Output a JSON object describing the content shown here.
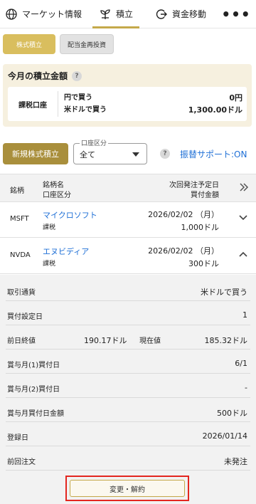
{
  "nav": {
    "market": "マーケット情報",
    "accumulate": "積立",
    "funds": "資金移動",
    "more": "•••"
  },
  "subtabs": {
    "stock": "株式積立",
    "dividend": "配当金再投資"
  },
  "summary": {
    "title": "今月の積立金額",
    "help": "?",
    "account": "課税口座",
    "rows": [
      {
        "label": "円で買う",
        "value": "0円"
      },
      {
        "label": "米ドルで買う",
        "value": "1,300.00ドル"
      }
    ]
  },
  "actions": {
    "new_button": "新規株式積立",
    "account_select_legend": "口座区分",
    "account_select_value": "全て",
    "help": "?",
    "swap_support": "振替サポート:ON"
  },
  "table": {
    "headers": {
      "symbol": "銘柄",
      "name": "銘柄名",
      "account": "口座区分",
      "next_date": "次回発注予定日",
      "amount": "買付金額"
    },
    "rows": [
      {
        "symbol": "MSFT",
        "name": "マイクロソフト",
        "account": "課税",
        "date": "2026/02/02 （月）",
        "amount": "1,000ドル"
      },
      {
        "symbol": "NVDA",
        "name": "エヌビディア",
        "account": "課税",
        "date": "2026/02/02 （月）",
        "amount": "300ドル"
      }
    ]
  },
  "detail": {
    "currency_label": "取引通貨",
    "currency_value": "米ドルで買う",
    "buy_day_label": "買付設定日",
    "buy_day_value": "1",
    "prev_close_label": "前日終値",
    "prev_close_value": "190.17ドル",
    "current_label": "現在値",
    "current_value": "185.32ドル",
    "bonus1_label": "賞与月(1)買付日",
    "bonus1_value": "6/1",
    "bonus2_label": "賞与月(2)買付日",
    "bonus2_value": "-",
    "bonus_amount_label": "賞与月買付日金額",
    "bonus_amount_value": "500ドル",
    "registered_label": "登録日",
    "registered_value": "2026/01/14",
    "last_order_label": "前回注文",
    "last_order_value": "未発注",
    "change_button": "変更・解約"
  },
  "colors": {
    "gold": "#c5a94a",
    "link": "#1e6fd6",
    "highlight": "#e3261f"
  }
}
